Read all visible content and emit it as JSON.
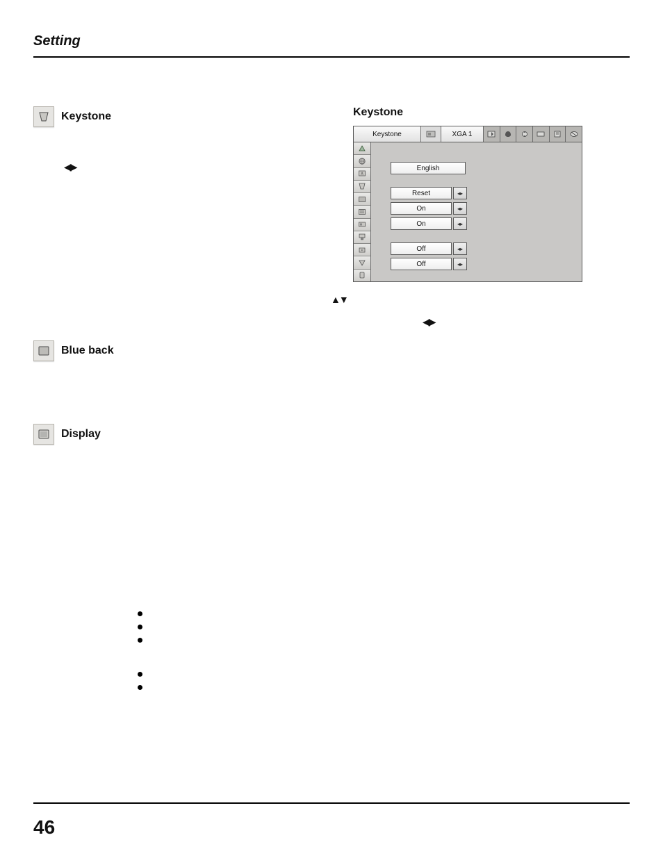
{
  "page": {
    "section_title": "Setting",
    "page_number": "46"
  },
  "sections": {
    "keystone": {
      "label": "Keystone"
    },
    "blueback": {
      "label": "Blue back"
    },
    "display": {
      "label": "Display"
    }
  },
  "arrows": {
    "lr": "◀▶",
    "ud": "▲▼",
    "lr_small": "◂▸"
  },
  "osd": {
    "title": "Keystone",
    "top": {
      "name": "Keystone",
      "mode": "XGA 1"
    },
    "rows": {
      "language": "English",
      "keystone": "Reset",
      "blueback": "On",
      "display": "On",
      "logo": "Off",
      "ceiling": "Off"
    }
  }
}
